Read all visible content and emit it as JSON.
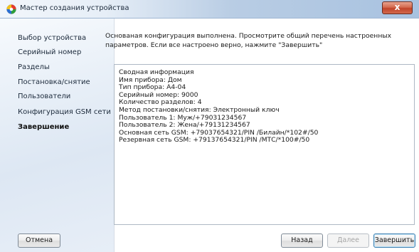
{
  "window": {
    "title": "Мастер создания устройства",
    "close_label": "x"
  },
  "sidebar": {
    "items": [
      {
        "label": "Выбор устройства",
        "active": false
      },
      {
        "label": "Серийный номер",
        "active": false
      },
      {
        "label": "Разделы",
        "active": false
      },
      {
        "label": "Постановка/снятие",
        "active": false
      },
      {
        "label": "Пользователи",
        "active": false
      },
      {
        "label": "Конфигурация GSM сети",
        "active": false
      },
      {
        "label": "Завершение",
        "active": true
      }
    ]
  },
  "main": {
    "intro": "Основаная конфигурация выполнена. Просмотрите общий перечень настроенных параметров. Если все настроено верно, нажмите \"Завершить\"",
    "summary": [
      "Сводная информация",
      "Имя прибора: Дом",
      "Тип прибора: А4-04",
      "Серийный номер: 9000",
      "Количество разделов: 4",
      "Метод постановки/снятия: Электронный ключ",
      "Пользователь 1: Муж/+79031234567",
      "Пользователь 2: Жена/+79131234567",
      "Основная сеть GSM: +79037654321/PIN /Билайн/*102#/50",
      "Резервная сеть GSM: +79137654321/PIN /МТС/*100#/50"
    ]
  },
  "buttons": {
    "cancel": "Отмена",
    "back": "Назад",
    "next": "Далее",
    "finish": "Завершить"
  },
  "colors": {
    "close_button": "#c94f35",
    "titlebar_accent": "#a8c2e0",
    "disabled_text": "#a6a6a6"
  }
}
